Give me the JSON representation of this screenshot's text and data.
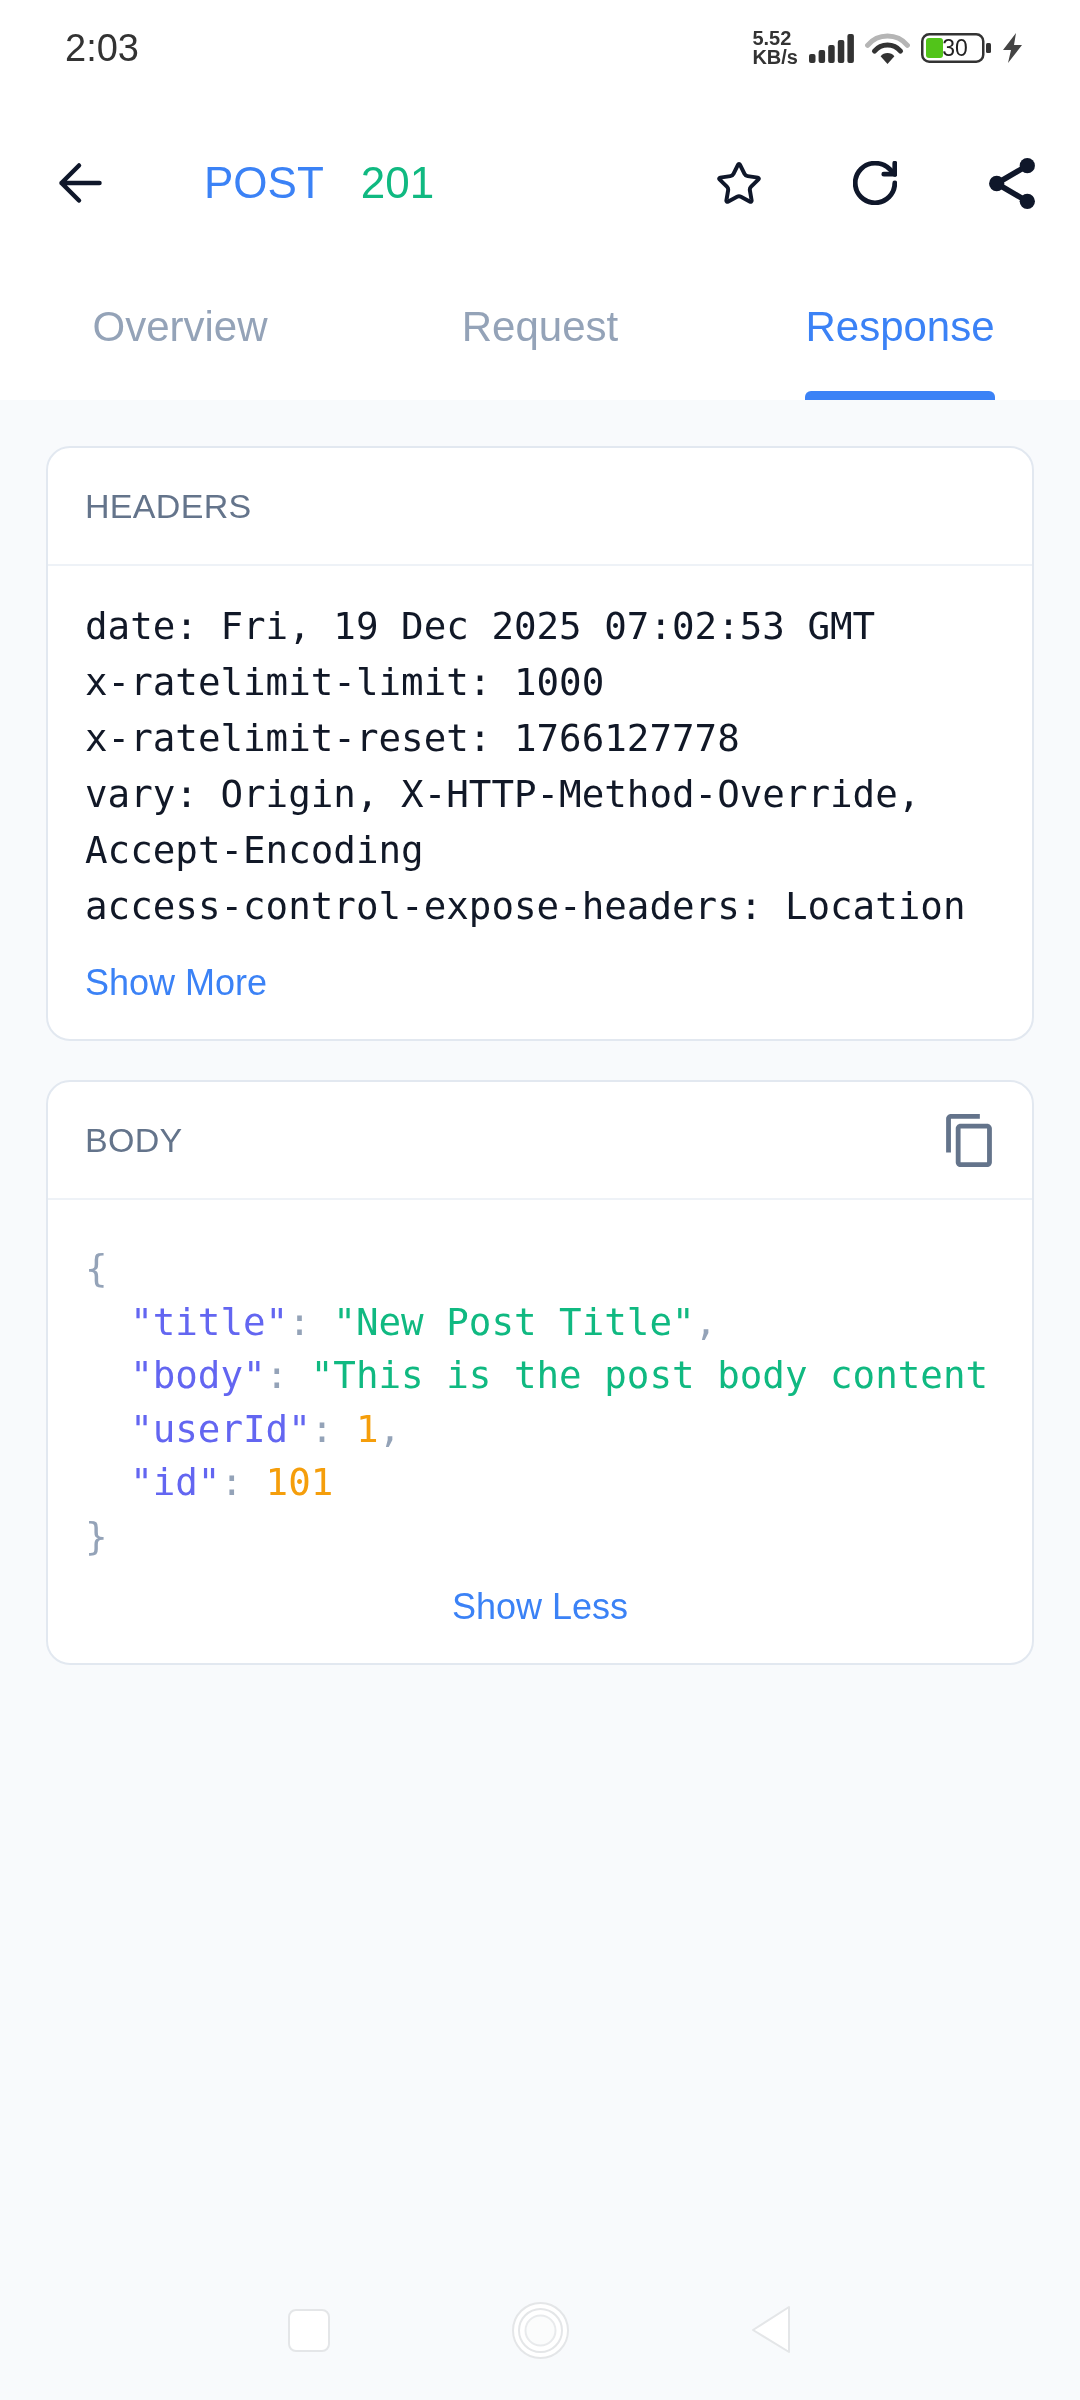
{
  "status_bar": {
    "time": "2:03",
    "net_speed": {
      "value": "5.52",
      "unit": "KB/s"
    },
    "battery": "30"
  },
  "toolbar": {
    "method": "POST",
    "status": "201"
  },
  "tabs": [
    {
      "label": "Overview",
      "selected": false
    },
    {
      "label": "Request",
      "selected": false
    },
    {
      "label": "Response",
      "selected": true
    }
  ],
  "headers": {
    "title": "HEADERS",
    "lines": [
      "date: Fri, 19 Dec 2025 07:02:53 GMT",
      "x-ratelimit-limit: 1000",
      "x-ratelimit-reset: 1766127778",
      "vary: Origin, X-HTTP-Method-Override, Accept-Encoding",
      "access-control-expose-headers: Location"
    ],
    "toggle": "Show More"
  },
  "body": {
    "title": "BODY",
    "open": "{",
    "entries": [
      {
        "key": "\"title\"",
        "colon": ": ",
        "value": "\"New Post Title\"",
        "kind": "string",
        "comma": ","
      },
      {
        "key": "\"body\"",
        "colon": ": ",
        "value": "\"This is the post body content",
        "kind": "string"
      },
      {
        "key": "\"userId\"",
        "colon": ": ",
        "value": "1",
        "kind": "number",
        "comma": ","
      },
      {
        "key": "\"id\"",
        "colon": ": ",
        "value": "101",
        "kind": "number"
      }
    ],
    "close": "}",
    "toggle": "Show Less"
  }
}
